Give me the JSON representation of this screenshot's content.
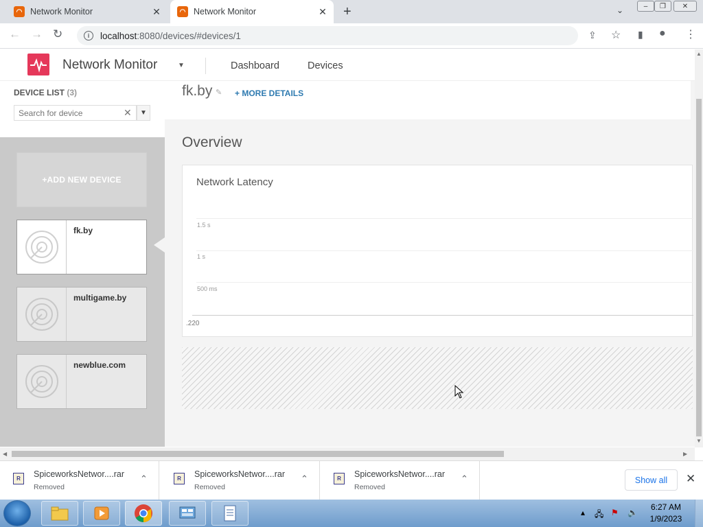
{
  "browser": {
    "tabs": [
      {
        "title": "Network Monitor",
        "active": false
      },
      {
        "title": "Network Monitor",
        "active": true
      }
    ],
    "url_host": "localhost",
    "url_rest": ":8080/devices/#devices/1"
  },
  "app": {
    "name": "Network Monitor",
    "nav": [
      "Dashboard",
      "Devices"
    ],
    "accent_color": "#e5385a"
  },
  "sidebar": {
    "title": "DEVICE LIST",
    "count": "(3)",
    "search_placeholder": "Search for device",
    "add_label": "ADD NEW DEVICE",
    "devices": [
      {
        "name": "fk.by",
        "selected": true
      },
      {
        "name": "multigame.by",
        "selected": false
      },
      {
        "name": "newblue.com",
        "selected": false
      }
    ]
  },
  "main": {
    "device_name": "fk.by",
    "more_details": "+ MORE DETAILS",
    "overview_title": "Overview",
    "latency_card": {
      "title": "Network Latency",
      "y_ticks": [
        "1.5 s",
        "1 s",
        "500 ms"
      ],
      "x_label": ".220"
    }
  },
  "downloads": {
    "items": [
      {
        "name": "SpiceworksNetwor....rar",
        "status": "Removed"
      },
      {
        "name": "SpiceworksNetwor....rar",
        "status": "Removed"
      },
      {
        "name": "SpiceworksNetwor....rar",
        "status": "Removed"
      }
    ],
    "show_all": "Show all"
  },
  "taskbar": {
    "time": "6:27 AM",
    "date": "1/9/2023"
  }
}
